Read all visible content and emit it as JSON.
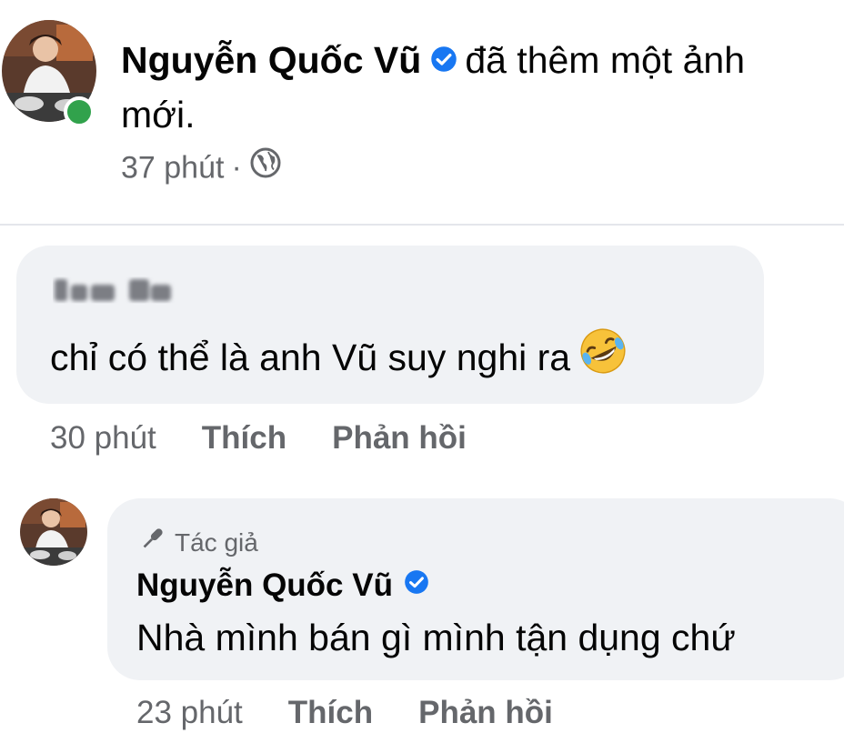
{
  "post": {
    "author": "Nguyễn Quốc Vũ",
    "action_line1": "đã thêm một ảnh",
    "action_line2": "mới.",
    "time": "37 phút",
    "separator": "·",
    "privacy_icon": "globe-icon",
    "verified_icon": "verified-badge-icon",
    "online_color": "#31a24c"
  },
  "comments": [
    {
      "author_blurred": true,
      "text": "chỉ có thể là anh Vũ suy nghi ra",
      "emoji": "rolling-on-floor-laughing-emoji",
      "time": "30 phút",
      "like_label": "Thích",
      "reply_label": "Phản hồi"
    }
  ],
  "reply": {
    "badge_icon": "microphone-icon",
    "badge_label": "Tác giả",
    "author": "Nguyễn Quốc Vũ",
    "text": "Nhà mình bán gì mình tận dụng chứ",
    "time": "23 phút",
    "like_label": "Thích",
    "reply_label": "Phản hồi"
  },
  "colors": {
    "verified_blue": "#1877f2",
    "bubble_bg": "#f0f2f5",
    "secondary_text": "#65676b"
  }
}
